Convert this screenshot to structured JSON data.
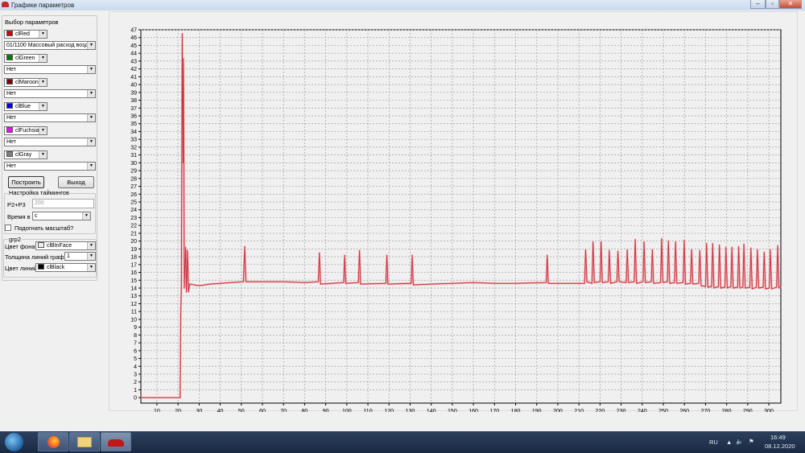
{
  "window": {
    "title": "Графики параметров",
    "min_icon": "minimize-icon",
    "max_icon": "maximize-icon",
    "close_icon": "close-icon"
  },
  "panel": {
    "group_title": "Выбор параметров",
    "slots": [
      {
        "color_name": "clRed",
        "color": "#e00000",
        "param": "01/1100 Массовый расход возд"
      },
      {
        "color_name": "clGreen",
        "color": "#008000",
        "param": "Нет"
      },
      {
        "color_name": "clMaroon",
        "color": "#800000",
        "param": "Нет"
      },
      {
        "color_name": "clBlue",
        "color": "#0000ff",
        "param": "Нет"
      },
      {
        "color_name": "clFuchsia",
        "color": "#ff00ff",
        "param": "Нет"
      },
      {
        "color_name": "clGray",
        "color": "#808080",
        "param": "Нет"
      }
    ],
    "build_button": "Построить",
    "exit_button": "Выход",
    "timings": {
      "title": "Настройка таймингов",
      "p_label": "P2+P3",
      "p_value": "200",
      "time_label": "Время в",
      "time_value": "с"
    },
    "fit_scale": {
      "label": "Подогнать масштаб?",
      "checked": false
    },
    "grp2": {
      "title": "grp2",
      "bg_label": "Цвет фона",
      "bg_value": "clBtnFace",
      "bg_color": "#f0f0f0",
      "width_label": "Толщина линий графика",
      "width_value": "1",
      "line_label": "Цвет линий",
      "line_value": "clBlack",
      "line_color": "#000000"
    }
  },
  "chart_data": {
    "type": "line",
    "xlim": [
      2.4,
      305.7
    ],
    "ylim": [
      -0.7,
      47
    ],
    "xticks": [
      10,
      20,
      30,
      40,
      50,
      60,
      70,
      80,
      90,
      100,
      110,
      120,
      130,
      140,
      150,
      160,
      170,
      180,
      190,
      200,
      210,
      220,
      230,
      240,
      250,
      260,
      270,
      280,
      290,
      300
    ],
    "yticks": [
      0,
      1,
      2,
      3,
      4,
      5,
      6,
      7,
      8,
      9,
      10,
      11,
      12,
      13,
      14,
      15,
      16,
      17,
      18,
      19,
      20,
      21,
      22,
      23,
      24,
      25,
      26,
      27,
      28,
      29,
      30,
      31,
      32,
      33,
      34,
      35,
      36,
      37,
      38,
      39,
      40,
      41,
      42,
      43,
      44,
      45,
      46,
      47
    ],
    "grid": true,
    "background": "#f0f0f0",
    "series": [
      {
        "color": "#c8323c",
        "points": [
          [
            2.4,
            0
          ],
          [
            21,
            0
          ],
          [
            21.3,
            10.5
          ],
          [
            21.6,
            14
          ],
          [
            22,
            46.5
          ],
          [
            22.4,
            30
          ],
          [
            22.6,
            43.3
          ],
          [
            23,
            14
          ],
          [
            23.6,
            19.2
          ],
          [
            24,
            13.5
          ],
          [
            24.5,
            18.8
          ],
          [
            25,
            13.5
          ],
          [
            25.5,
            14.5
          ],
          [
            30,
            14.3
          ],
          [
            35,
            14.5
          ],
          [
            40,
            14.6
          ],
          [
            45,
            14.7
          ],
          [
            51,
            14.8
          ],
          [
            51.6,
            19.3
          ],
          [
            52.2,
            14.8
          ],
          [
            60,
            14.8
          ],
          [
            70,
            14.8
          ],
          [
            80,
            14.7
          ],
          [
            86.5,
            14.8
          ],
          [
            87,
            18.5
          ],
          [
            87.5,
            14.5
          ],
          [
            98.5,
            14.7
          ],
          [
            99,
            18.2
          ],
          [
            99.5,
            14.6
          ],
          [
            105.5,
            14.7
          ],
          [
            106,
            18.8
          ],
          [
            106.5,
            14.5
          ],
          [
            118.5,
            14.6
          ],
          [
            119,
            18.2
          ],
          [
            119.5,
            14.5
          ],
          [
            130.5,
            14.6
          ],
          [
            131,
            18.2
          ],
          [
            131.5,
            14.4
          ],
          [
            140,
            14.5
          ],
          [
            150,
            14.6
          ],
          [
            160,
            14.7
          ],
          [
            170,
            14.6
          ],
          [
            180,
            14.6
          ],
          [
            194.5,
            14.7
          ],
          [
            195,
            18.2
          ],
          [
            195.5,
            14.6
          ],
          [
            212.7,
            14.6
          ],
          [
            213.2,
            18.9
          ],
          [
            213.8,
            14.8
          ],
          [
            216.2,
            14.6
          ],
          [
            216.7,
            19.9
          ],
          [
            217.3,
            14.7
          ],
          [
            220,
            14.8
          ],
          [
            220.5,
            19.9
          ],
          [
            221.1,
            14.7
          ],
          [
            223.9,
            14.8
          ],
          [
            224.4,
            18.8
          ],
          [
            225,
            14.6
          ],
          [
            228,
            14.8
          ],
          [
            228.5,
            18.7
          ],
          [
            229.1,
            14.8
          ],
          [
            232.4,
            14.7
          ],
          [
            232.9,
            18.9
          ],
          [
            233.5,
            14.7
          ],
          [
            236.2,
            14.8
          ],
          [
            236.7,
            20.2
          ],
          [
            237.3,
            14.6
          ],
          [
            240.4,
            14.8
          ],
          [
            240.9,
            19.9
          ],
          [
            241.5,
            14.7
          ],
          [
            244.3,
            14.8
          ],
          [
            244.8,
            18.9
          ],
          [
            245.4,
            14.6
          ],
          [
            248.7,
            14.7
          ],
          [
            249.2,
            20.3
          ],
          [
            249.8,
            14.7
          ],
          [
            251.9,
            14.8
          ],
          [
            252.4,
            20
          ],
          [
            253,
            14.6
          ],
          [
            255.3,
            14.7
          ],
          [
            255.8,
            19.9
          ],
          [
            256.4,
            14.6
          ],
          [
            259.4,
            14.7
          ],
          [
            259.9,
            20.1
          ],
          [
            260.5,
            14.5
          ],
          [
            262.9,
            14.6
          ],
          [
            263.4,
            18.9
          ],
          [
            264,
            14.5
          ],
          [
            266.8,
            14.6
          ],
          [
            267.3,
            18.8
          ],
          [
            267.9,
            14.3
          ],
          [
            270,
            14.2
          ],
          [
            270.5,
            19.7
          ],
          [
            271.1,
            14.1
          ],
          [
            272.9,
            14.2
          ],
          [
            273.4,
            19.7
          ],
          [
            274,
            14
          ],
          [
            276.1,
            14.2
          ],
          [
            276.6,
            19.5
          ],
          [
            277.2,
            14
          ],
          [
            279.2,
            14.1
          ],
          [
            279.7,
            19.2
          ],
          [
            280.3,
            14
          ],
          [
            282,
            14.2
          ],
          [
            282.5,
            19.2
          ],
          [
            283.1,
            14
          ],
          [
            285.2,
            14.1
          ],
          [
            285.7,
            19.3
          ],
          [
            286.3,
            14
          ],
          [
            287.7,
            14.1
          ],
          [
            288.2,
            19.6
          ],
          [
            288.8,
            14
          ],
          [
            291,
            14.1
          ],
          [
            291.5,
            19.1
          ],
          [
            292.1,
            13.9
          ],
          [
            294.1,
            14.1
          ],
          [
            294.6,
            18.9
          ],
          [
            295.2,
            14
          ],
          [
            297.3,
            14.1
          ],
          [
            297.8,
            18.6
          ],
          [
            298.4,
            13.9
          ],
          [
            300.2,
            14
          ],
          [
            300.7,
            18.9
          ],
          [
            301.3,
            13.9
          ],
          [
            303.7,
            14.1
          ],
          [
            304.2,
            19.4
          ],
          [
            304.8,
            14
          ],
          [
            305.7,
            14.2
          ]
        ]
      }
    ]
  },
  "taskbar": {
    "apps": [
      "windows-start",
      "firefox",
      "file-explorer",
      "car-app"
    ],
    "lang": "RU",
    "time": "16:49",
    "date": "08.12.2020"
  }
}
